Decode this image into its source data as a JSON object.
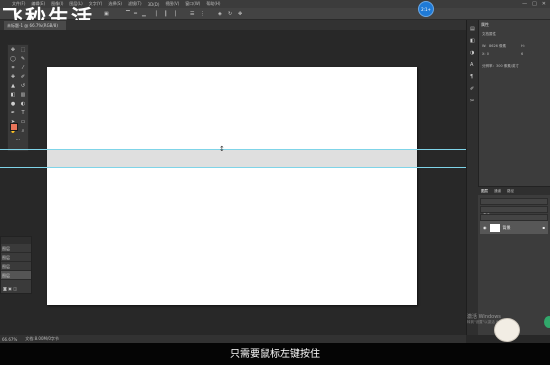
{
  "watermark": "飞秒生活",
  "menu": [
    "文件(F)",
    "编辑(E)",
    "图像(I)",
    "图层(L)",
    "文字(Y)",
    "选择(S)",
    "滤镜(T)",
    "3D(D)",
    "视图(V)",
    "窗口(W)",
    "帮助(H)"
  ],
  "window_controls": [
    "—",
    "□",
    "✕"
  ],
  "document_tab": "未标题-1 @ 66.7%(RGB/8)",
  "user_badge": "2:1+",
  "properties": {
    "tab": "属性",
    "kind": "文档属性",
    "width_label": "W:",
    "width_value": "8626 像素",
    "height_label": "H:",
    "height_value": "6",
    "xy_label": "X: 0",
    "resolution": "分辨率：300 像素/英寸"
  },
  "layers": {
    "tabs": [
      "图层",
      "通道",
      "路径"
    ],
    "active_tab": "图层",
    "kind_label": "类型",
    "blend_label": "正常",
    "opacity_label": "不透明度",
    "lock_label": "锁定:",
    "fill_label": "填充",
    "layer_name": "背景"
  },
  "mini_panel_rows": [
    "图层",
    "图层",
    "图层",
    "图层"
  ],
  "status": {
    "zoom": "66.67%",
    "doc_info": "文档:8.00M/0字节"
  },
  "activate_windows": "激活 Windows",
  "activate_windows_hint": "转到\"设置\"以激活 Windows。",
  "subtitle": "只需要鼠标左键按住",
  "colors": {
    "foreground": "#e8745a",
    "background": "#ffffff",
    "guide": "#7fd4e8",
    "canvas": "#ffffff",
    "workspace": "#282828"
  },
  "icons": [
    "move-icon",
    "marquee-icon",
    "lasso-icon",
    "quick-select-icon",
    "crop-icon",
    "eyedropper-icon",
    "healing-icon",
    "brush-icon",
    "stamp-icon",
    "history-brush-icon",
    "eraser-icon",
    "gradient-icon",
    "blur-icon",
    "dodge-icon",
    "pen-icon",
    "type-icon",
    "path-select-icon",
    "shape-icon",
    "hand-icon",
    "zoom-icon",
    "edit-toolbar-icon"
  ]
}
